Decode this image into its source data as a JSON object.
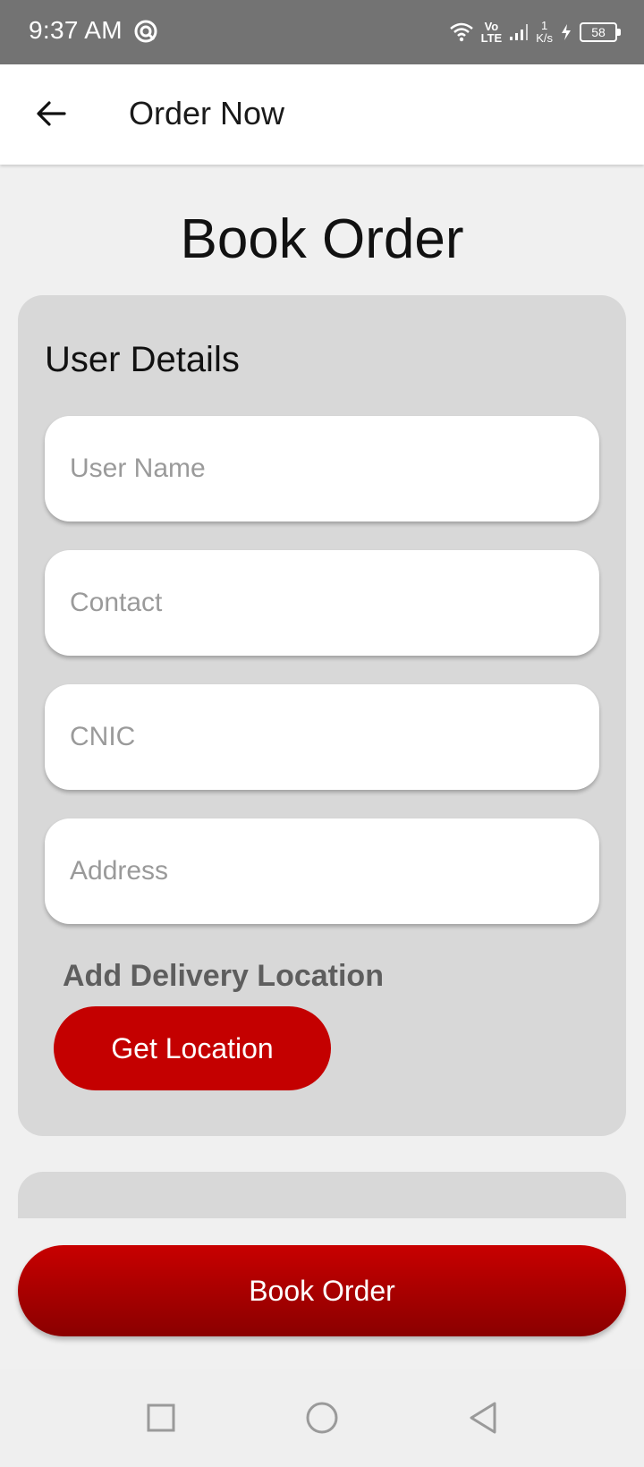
{
  "status_bar": {
    "time": "9:37 AM",
    "network_top": "Vo",
    "network_bottom": "LTE",
    "speed_value": "1",
    "speed_unit": "K/s",
    "battery": "58",
    "icons": [
      "sync-icon",
      "wifi-icon",
      "signal-icon",
      "charging-icon",
      "battery-icon"
    ]
  },
  "app_bar": {
    "title": "Order Now",
    "back_icon": "arrow-left-icon"
  },
  "page": {
    "title": "Book Order"
  },
  "user_details": {
    "title": "User Details",
    "fields": [
      {
        "placeholder": "User Name",
        "value": ""
      },
      {
        "placeholder": "Contact",
        "value": ""
      },
      {
        "placeholder": "CNIC",
        "value": ""
      },
      {
        "placeholder": "Address",
        "value": ""
      }
    ],
    "delivery_label": "Add Delivery Location",
    "get_location_label": "Get Location"
  },
  "book_button_label": "Book Order",
  "nav_bar": {
    "icons": [
      "square-recents-icon",
      "circle-home-icon",
      "triangle-back-icon"
    ]
  },
  "colors": {
    "accent": "#c40000",
    "accent_dark": "#8a0000",
    "status_bar": "#737373",
    "card": "#d8d8d8",
    "background": "#f0f0f0"
  }
}
